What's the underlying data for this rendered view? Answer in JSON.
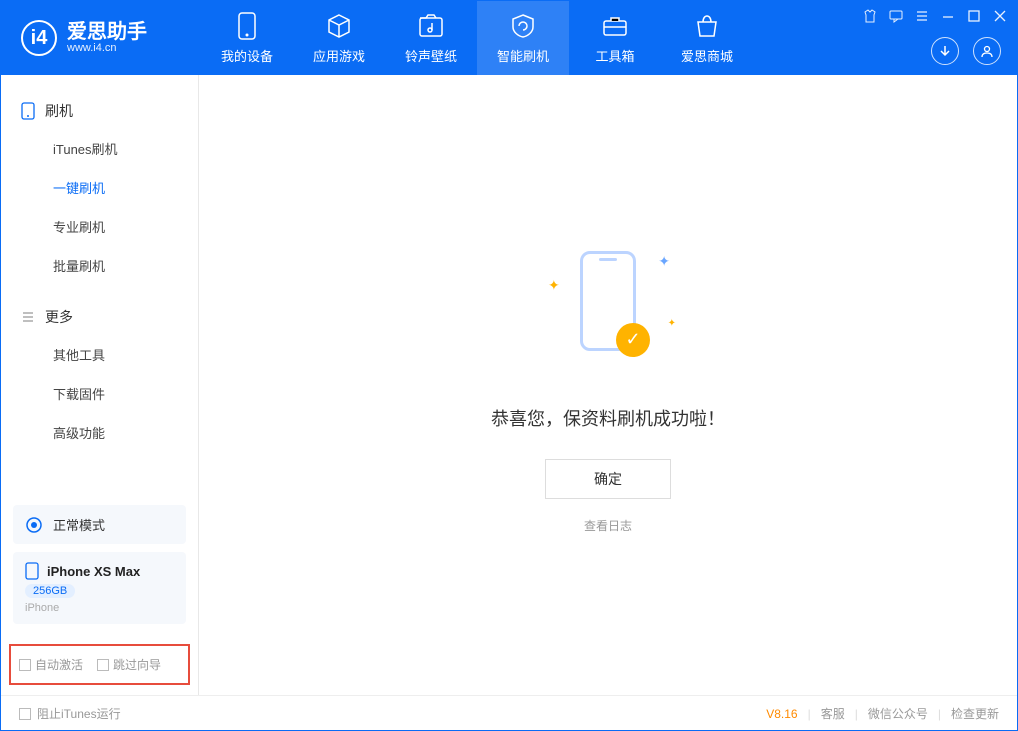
{
  "app": {
    "title": "爱思助手",
    "subtitle": "www.i4.cn"
  },
  "nav": {
    "tabs": [
      {
        "label": "我的设备"
      },
      {
        "label": "应用游戏"
      },
      {
        "label": "铃声壁纸"
      },
      {
        "label": "智能刷机"
      },
      {
        "label": "工具箱"
      },
      {
        "label": "爱思商城"
      }
    ],
    "active_index": 3
  },
  "sidebar": {
    "group1_title": "刷机",
    "group1_items": [
      {
        "label": "iTunes刷机"
      },
      {
        "label": "一键刷机"
      },
      {
        "label": "专业刷机"
      },
      {
        "label": "批量刷机"
      }
    ],
    "group1_active_index": 1,
    "group2_title": "更多",
    "group2_items": [
      {
        "label": "其他工具"
      },
      {
        "label": "下载固件"
      },
      {
        "label": "高级功能"
      }
    ]
  },
  "device": {
    "mode_label": "正常模式",
    "name": "iPhone XS Max",
    "capacity": "256GB",
    "type": "iPhone"
  },
  "options": {
    "auto_activate_label": "自动激活",
    "skip_guide_label": "跳过向导"
  },
  "main": {
    "success_message": "恭喜您，保资料刷机成功啦！",
    "ok_button": "确定",
    "view_log": "查看日志"
  },
  "footer": {
    "block_itunes_label": "阻止iTunes运行",
    "version": "V8.16",
    "links": [
      {
        "label": "客服"
      },
      {
        "label": "微信公众号"
      },
      {
        "label": "检查更新"
      }
    ]
  }
}
